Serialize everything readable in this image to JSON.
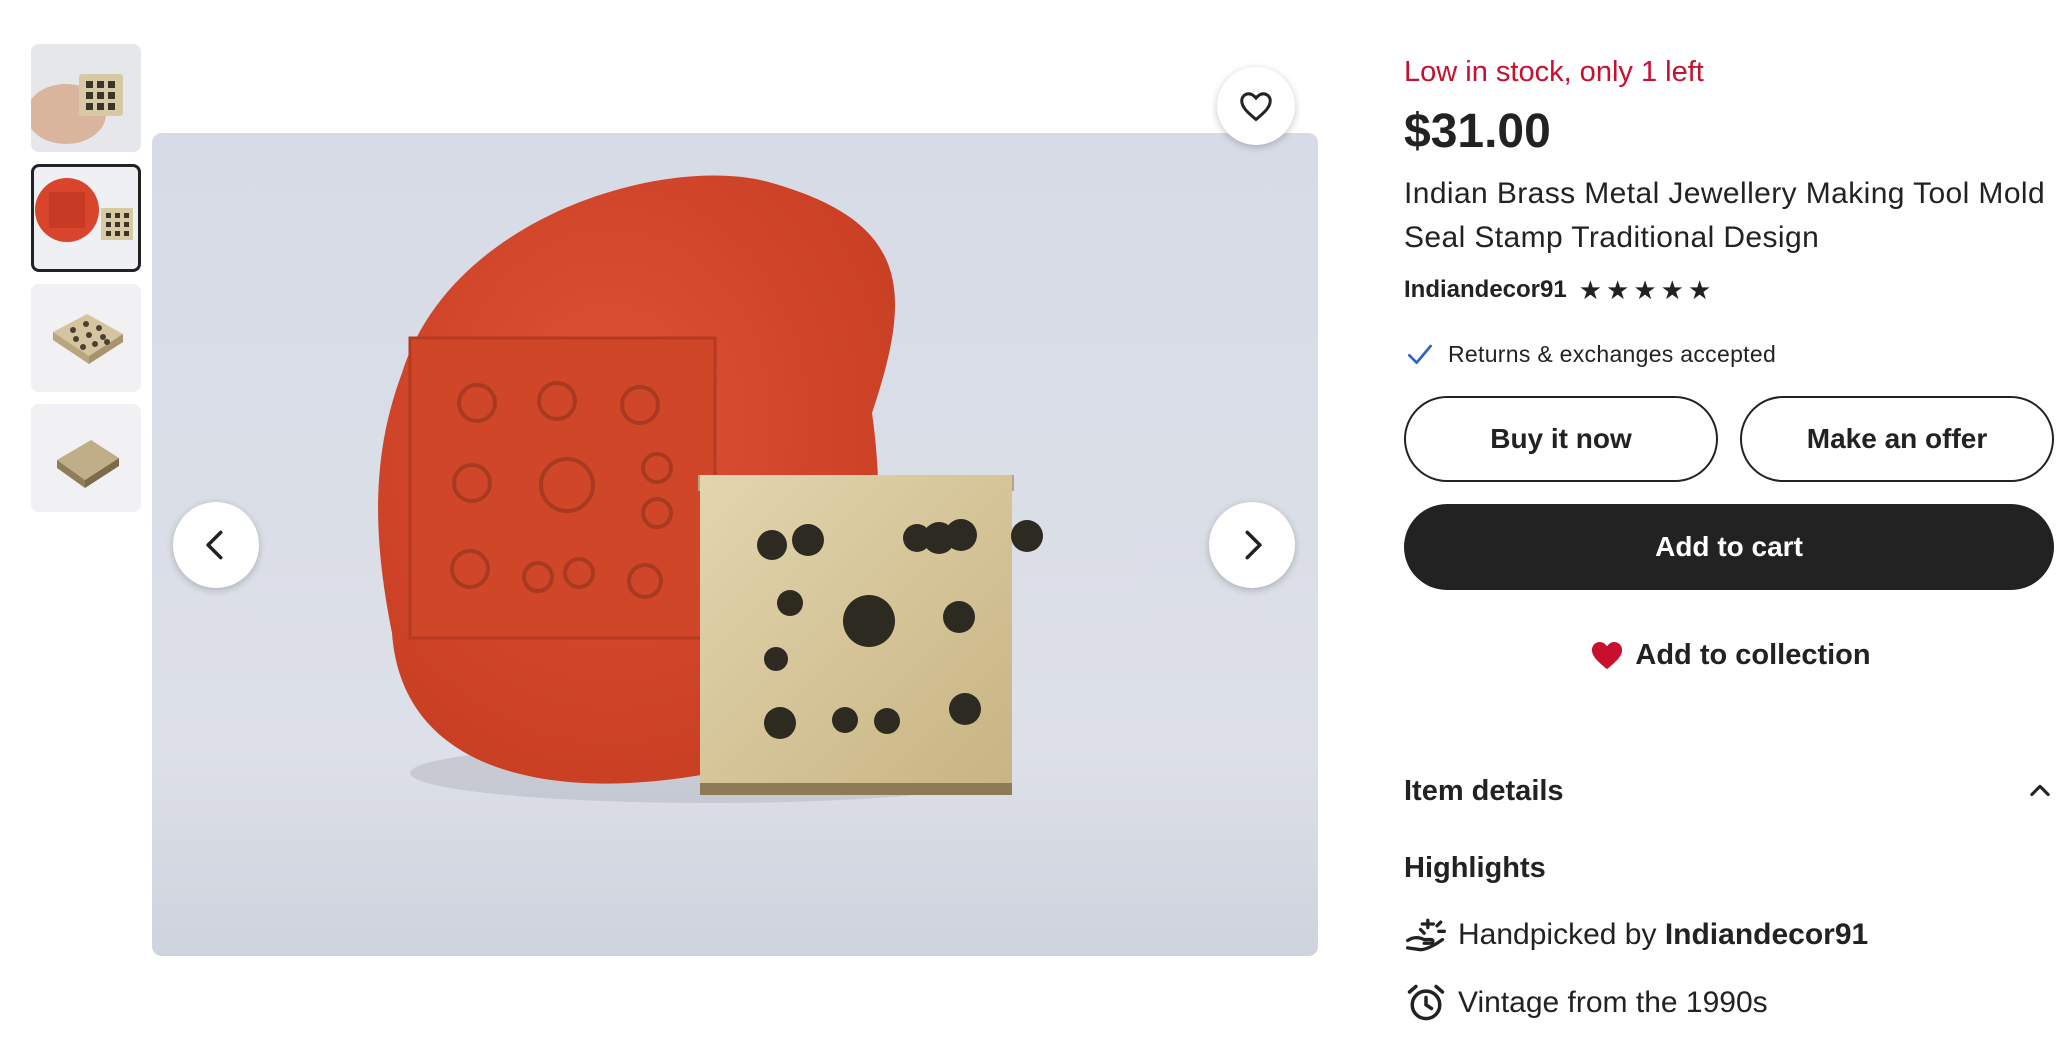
{
  "gallery": {
    "thumbnails": [
      {
        "alt": "stamp held in hand"
      },
      {
        "alt": "clay impression with stamp"
      },
      {
        "alt": "stamp top view"
      },
      {
        "alt": "stamp angled view"
      }
    ],
    "active_index": 1
  },
  "product": {
    "stock_notice": "Low in stock, only 1 left",
    "price": "$31.00",
    "title": "Indian Brass Metal Jewellery Making Tool Mold Seal Stamp Traditional Design",
    "seller": "Indiandecor91",
    "rating_stars": 5,
    "returns_text": "Returns & exchanges accepted"
  },
  "actions": {
    "buy_now": "Buy it now",
    "make_offer": "Make an offer",
    "add_to_cart": "Add to cart",
    "add_to_collection": "Add to collection"
  },
  "details": {
    "section_title": "Item details",
    "highlights_title": "Highlights",
    "handpicked_prefix": "Handpicked by",
    "handpicked_by": "Indiandecor91",
    "vintage": "Vintage from the 1990s"
  },
  "colors": {
    "accent_red": "#c8102e",
    "primary_dark": "#222222",
    "check_blue": "#2f5fd0"
  },
  "icons": {
    "favorite": "heart-outline-icon",
    "prev": "chevron-left-icon",
    "next": "chevron-right-icon",
    "returns": "checkmark-icon",
    "collection": "heart-filled-icon",
    "collapse": "chevron-up-icon",
    "handpicked": "hand-sparkle-icon",
    "vintage": "alarm-clock-icon"
  }
}
